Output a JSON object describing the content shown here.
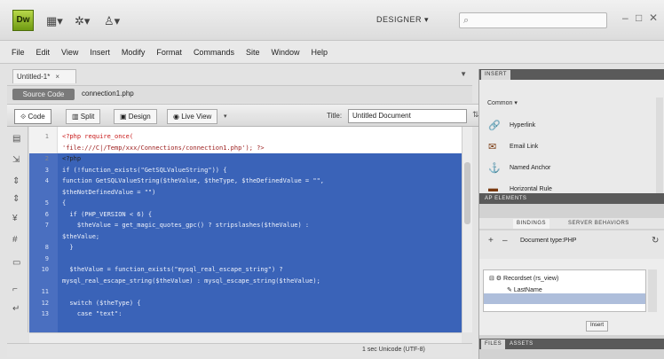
{
  "app": {
    "logo_text": "Dw",
    "toolbar_icons": [
      "layout-icon",
      "gear-icon",
      "user-icon"
    ],
    "workspace": "DESIGNER",
    "search_placeholder": ""
  },
  "menu": [
    "File",
    "Edit",
    "View",
    "Insert",
    "Modify",
    "Format",
    "Commands",
    "Site",
    "Window",
    "Help"
  ],
  "document": {
    "tab_label": "Untitled-1*",
    "source_code_label": "Source Code",
    "related_file": "connection1.php",
    "views": [
      "Code",
      "Split",
      "Design",
      "Live View"
    ],
    "title_label": "Title:",
    "title_value": "Untitled Document"
  },
  "code_lines": [
    {
      "n": "1",
      "text": "<?php require_once(",
      "cls": "red",
      "sel": false
    },
    {
      "n": "",
      "text": "'file:///C|/Temp/xxx/Connections/connection1.php'); ?>",
      "cls": "dk-red",
      "sel": false
    },
    {
      "n": "2",
      "text": "<?php",
      "cls": "",
      "sel": false
    },
    {
      "n": "3",
      "text": "if (!function_exists(\"GetSQLValueString\")) {",
      "cls": "",
      "sel": true
    },
    {
      "n": "4",
      "text": "function GetSQLValueString($theValue, $theType, $theDefinedValue = \"\",",
      "cls": "",
      "sel": true
    },
    {
      "n": "",
      "text": "$theNotDefinedValue = \"\")",
      "cls": "",
      "sel": true
    },
    {
      "n": "5",
      "text": "{",
      "cls": "",
      "sel": true
    },
    {
      "n": "6",
      "text": "  if (PHP_VERSION < 6) {",
      "cls": "",
      "sel": true
    },
    {
      "n": "7",
      "text": "    $theValue = get_magic_quotes_gpc() ? stripslashes($theValue) :",
      "cls": "",
      "sel": true
    },
    {
      "n": "",
      "text": "$theValue;",
      "cls": "",
      "sel": true
    },
    {
      "n": "8",
      "text": "  }",
      "cls": "",
      "sel": true
    },
    {
      "n": "9",
      "text": "",
      "cls": "",
      "sel": true
    },
    {
      "n": "10",
      "text": "  $theValue = function_exists(\"mysql_real_escape_string\") ?",
      "cls": "",
      "sel": true
    },
    {
      "n": "",
      "text": "mysql_real_escape_string($theValue) : mysql_escape_string($theValue);",
      "cls": "",
      "sel": true
    },
    {
      "n": "11",
      "text": "",
      "cls": "",
      "sel": true
    },
    {
      "n": "12",
      "text": "  switch ($theType) {",
      "cls": "",
      "sel": true
    },
    {
      "n": "13",
      "text": "    case \"text\":",
      "cls": "",
      "sel": true
    }
  ],
  "status": "1 sec  Unicode (UTF-8)",
  "panels": {
    "insert_tab": "INSERT",
    "insert_category": "Common",
    "insert_items": [
      {
        "icon": "hyperlink-icon",
        "label": "Hyperlink"
      },
      {
        "icon": "email-link-icon",
        "label": "Email Link"
      },
      {
        "icon": "anchor-icon",
        "label": "Named Anchor"
      },
      {
        "icon": "horizontal-rule-icon",
        "label": "Horizontal Rule"
      }
    ],
    "css_tab": "AP ELEMENTS",
    "bindings_tabs": [
      "BINDINGS",
      "SERVER BEHAVIORS"
    ],
    "doc_type": "Document type:PHP",
    "tree": {
      "recordset": "Recordset (rs_view)",
      "field": "LastName"
    },
    "insert_button": "Insert",
    "bottom_tabs": [
      "FILES",
      "ASSETS"
    ]
  }
}
